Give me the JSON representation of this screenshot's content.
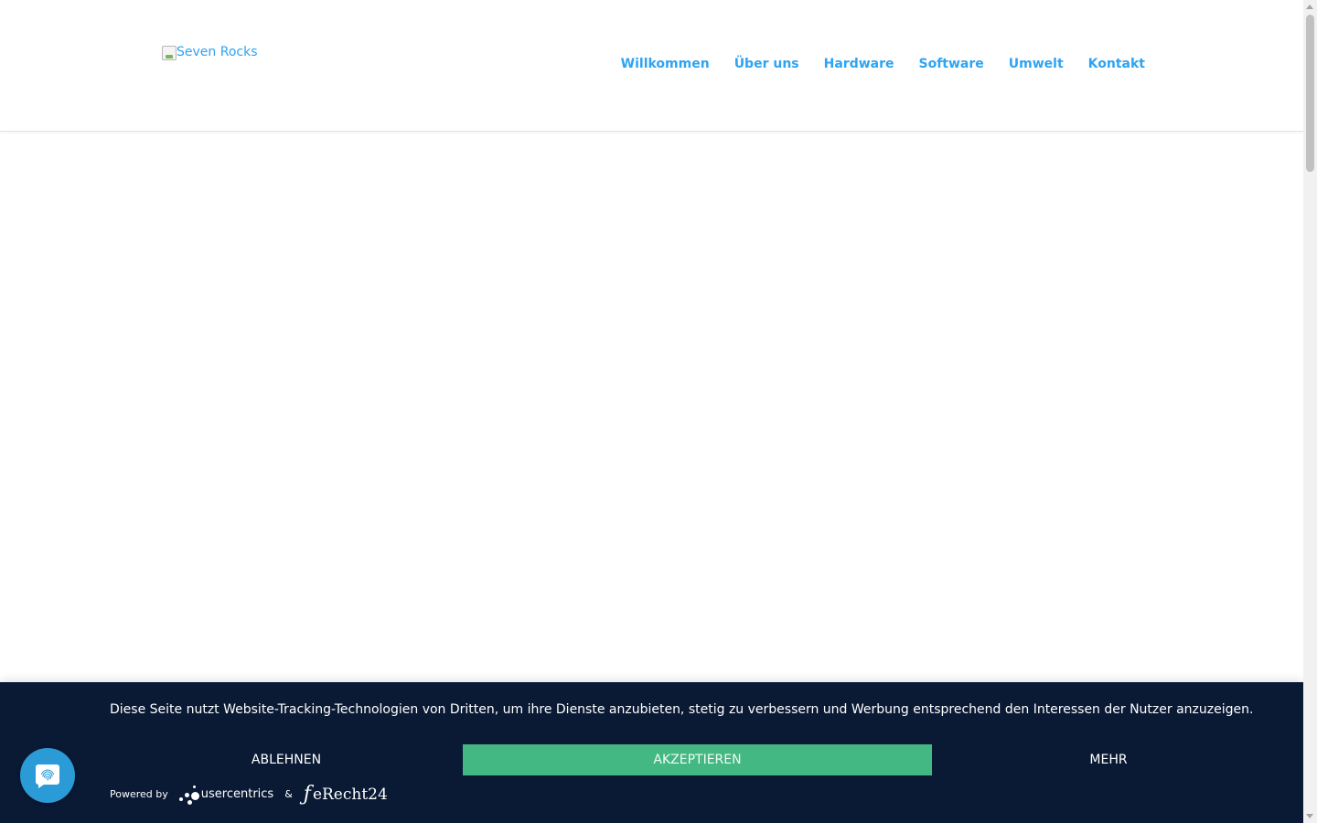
{
  "header": {
    "logo_alt": "Seven Rocks",
    "nav": [
      "Willkommen",
      "Über uns",
      "Hardware",
      "Software",
      "Umwelt",
      "Kontakt"
    ]
  },
  "cookie_banner": {
    "message": "Diese Seite nutzt Website-Tracking-Technologien von Dritten, um ihre Dienste anzubieten, stetig zu verbessern und Werbung entsprechend den Interessen der Nutzer anzuzeigen.",
    "decline_label": "ABLEHNEN",
    "accept_label": "AKZEPTIEREN",
    "more_label": "MEHR",
    "powered_by": "Powered by",
    "brand_usercentrics": "usercentrics",
    "ampersand": "&",
    "brand_erecht": "eRecht24"
  },
  "privacy_button": {
    "icon": "fingerprint-icon"
  },
  "colors": {
    "link": "#2ea3f2",
    "banner_bg": "#0a1a35",
    "accept_bg": "#43b882",
    "privacy_button_bg": "#2a9bd6"
  }
}
